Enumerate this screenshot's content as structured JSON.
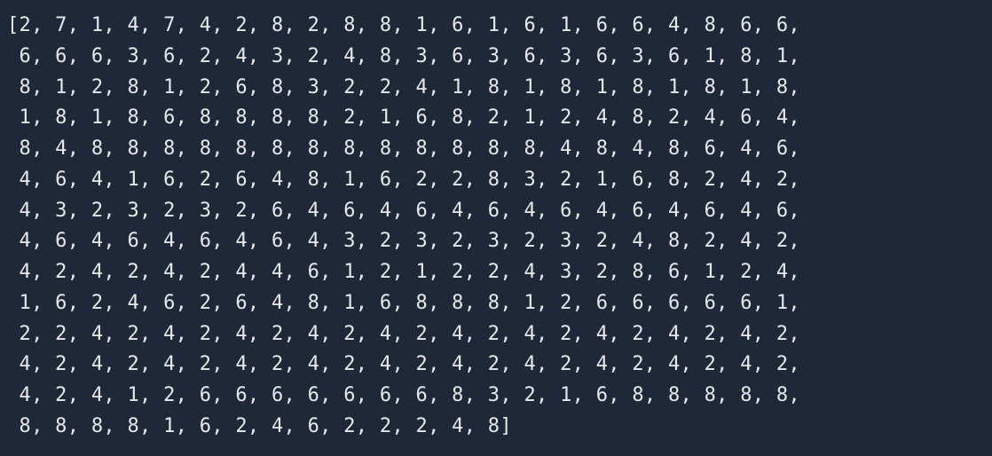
{
  "array": [
    2,
    7,
    1,
    4,
    7,
    4,
    2,
    8,
    2,
    8,
    8,
    1,
    6,
    1,
    6,
    1,
    6,
    6,
    4,
    8,
    6,
    6,
    6,
    6,
    6,
    3,
    6,
    2,
    4,
    3,
    2,
    4,
    8,
    3,
    6,
    3,
    6,
    3,
    6,
    3,
    6,
    1,
    8,
    1,
    8,
    1,
    2,
    8,
    1,
    2,
    6,
    8,
    3,
    2,
    2,
    4,
    1,
    8,
    1,
    8,
    1,
    8,
    1,
    8,
    1,
    8,
    1,
    8,
    1,
    8,
    6,
    8,
    8,
    8,
    8,
    2,
    1,
    6,
    8,
    2,
    1,
    2,
    4,
    8,
    2,
    4,
    6,
    4,
    8,
    4,
    8,
    8,
    8,
    8,
    8,
    8,
    8,
    8,
    8,
    8,
    8,
    8,
    8,
    4,
    8,
    4,
    8,
    6,
    4,
    6,
    4,
    6,
    4,
    1,
    6,
    2,
    6,
    4,
    8,
    1,
    6,
    2,
    2,
    8,
    3,
    2,
    1,
    6,
    8,
    2,
    4,
    2,
    4,
    3,
    2,
    3,
    2,
    3,
    2,
    6,
    4,
    6,
    4,
    6,
    4,
    6,
    4,
    6,
    4,
    6,
    4,
    6,
    4,
    6,
    4,
    6,
    4,
    6,
    4,
    6,
    4,
    6,
    4,
    3,
    2,
    3,
    2,
    3,
    2,
    3,
    2,
    4,
    8,
    2,
    4,
    2,
    4,
    2,
    4,
    2,
    4,
    2,
    4,
    4,
    6,
    1,
    2,
    1,
    2,
    2,
    4,
    3,
    2,
    8,
    6,
    1,
    2,
    4,
    1,
    6,
    2,
    4,
    6,
    2,
    6,
    4,
    8,
    1,
    6,
    8,
    8,
    8,
    1,
    2,
    6,
    6,
    6,
    6,
    6,
    1,
    2,
    2,
    4,
    2,
    4,
    2,
    4,
    2,
    4,
    2,
    4,
    2,
    4,
    2,
    4,
    2,
    4,
    2,
    4,
    2,
    4,
    2,
    4,
    2,
    4,
    2,
    4,
    2,
    4,
    2,
    4,
    2,
    4,
    2,
    4,
    2,
    4,
    2,
    4,
    2,
    4,
    2,
    4,
    2,
    4,
    2,
    4,
    1,
    2,
    6,
    6,
    6,
    6,
    6,
    6,
    6,
    8,
    3,
    2,
    1,
    6,
    8,
    8,
    8,
    8,
    8,
    8,
    8,
    8,
    8,
    1,
    6,
    2,
    4,
    6,
    2,
    2,
    2,
    4,
    8
  ],
  "items_per_line": 22,
  "prompt": ""
}
